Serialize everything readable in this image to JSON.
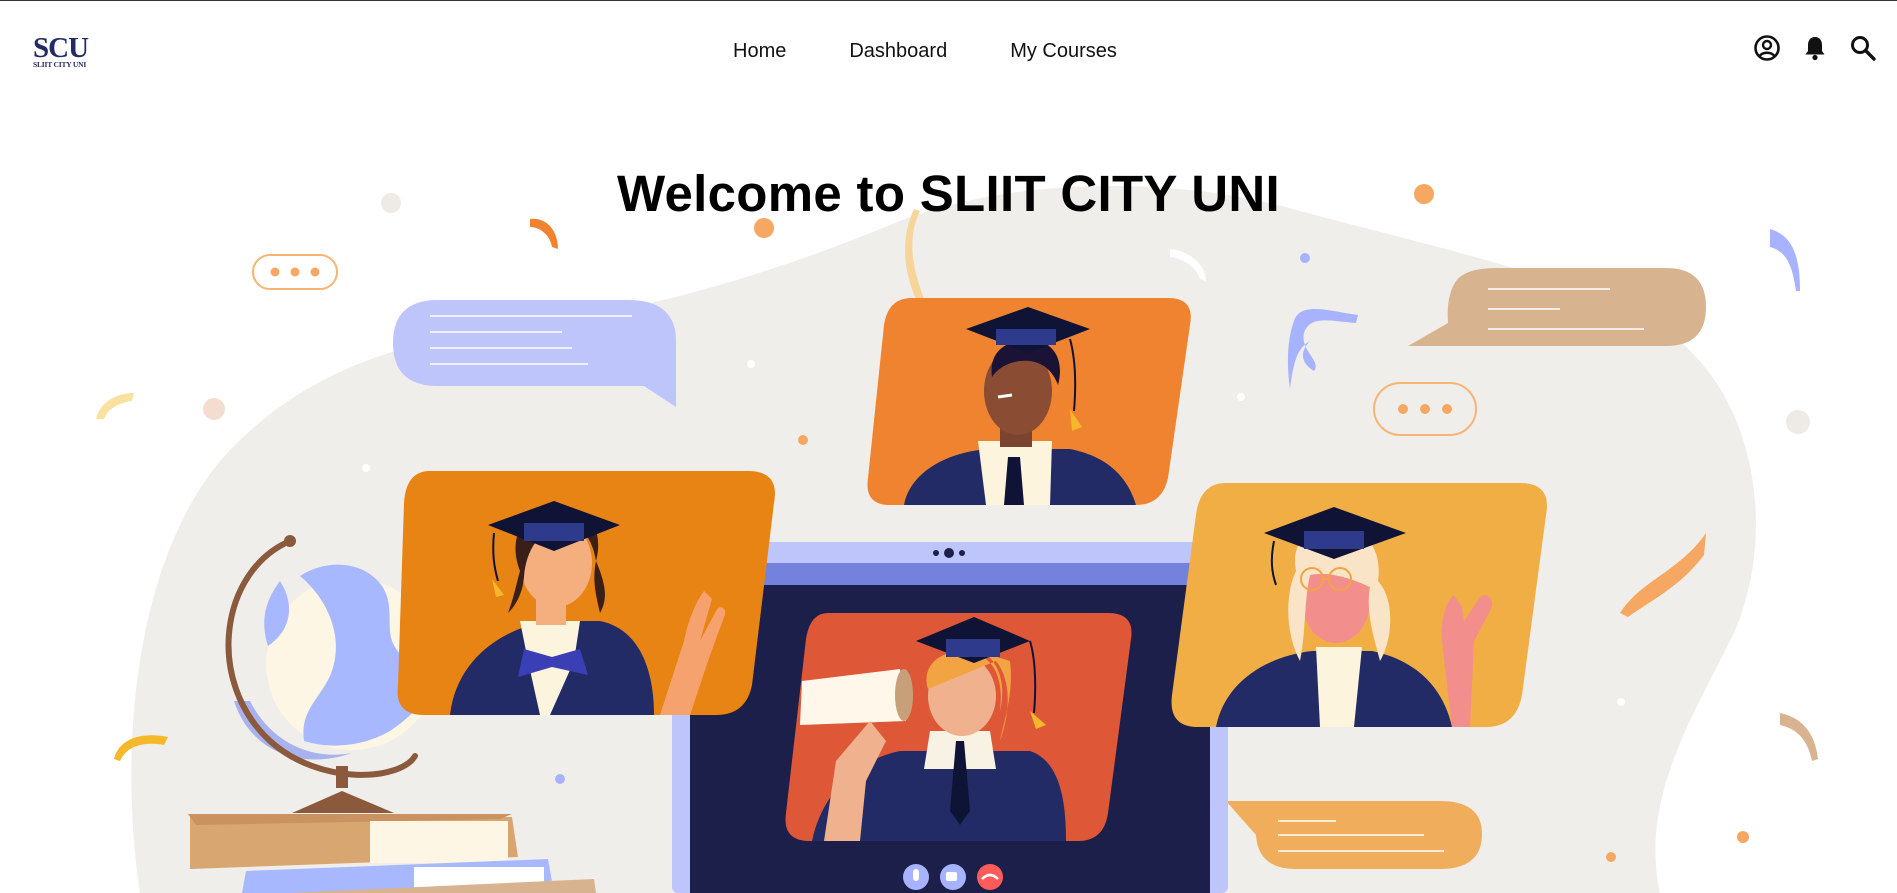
{
  "brand": {
    "logo_main": "SCU",
    "logo_sub": "SLIIT CITY UNI"
  },
  "nav": {
    "links": [
      "Home",
      "Dashboard",
      "My Courses"
    ],
    "icons": [
      "account-circle-icon",
      "bell-icon",
      "search-icon"
    ]
  },
  "hero": {
    "title": "Welcome to SLIIT CITY UNI"
  },
  "colors": {
    "brand_navy": "#232b66",
    "blob": "#f0eeeb",
    "orange": "#f0832f",
    "amber": "#e88414",
    "gold": "#f0ae45",
    "red_orange": "#de5838",
    "lavender": "#bdc5fb",
    "tan": "#d8b38f",
    "screen_navy": "#1c1f4a"
  }
}
